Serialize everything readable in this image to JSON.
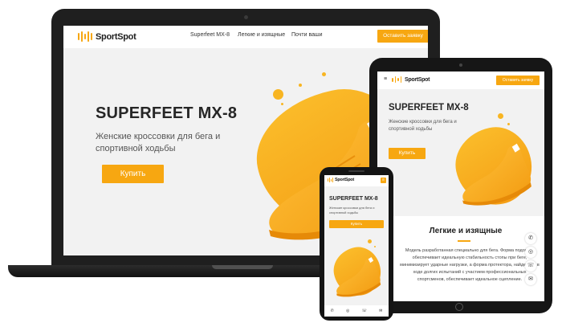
{
  "brand": {
    "name": "SportSpot",
    "color": "#f7a711"
  },
  "laptop": {
    "nav": [
      "Superfeet MX-8",
      "Легкие и изящные",
      "Почти ваши"
    ],
    "cta": "Оставить заявку",
    "hero_title": "SUPERFEET MX-8",
    "hero_subtitle": "Женские кроссовки для бега и спортивной ходьбы",
    "buy": "Купить"
  },
  "tablet": {
    "cta": "Оставить заявку",
    "hero_title": "SUPERFEET MX-8",
    "hero_subtitle": "Женские кроссовки для бега и спортивной ходьбы",
    "buy": "Купить",
    "section_title": "Легкие и изящные",
    "section_text": "Модель разработанная специально для бега. Форма подошвы обеспечивает идеальную стабильность стопы при беге, минимизирует ударные нагрузки, а форма протектора, найденная в ходе долгих испытаний с участием профессиональных спортсменов, обеспечивает идеальное сцепление.",
    "side_icons": [
      "phone-icon",
      "instagram-icon",
      "whatsapp-icon",
      "mail-icon"
    ]
  },
  "phone": {
    "hero_title": "SUPERFEET MX-8",
    "hero_subtitle": "Женские кроссовки для бега и спортивной ходьбы",
    "buy": "Купить",
    "bottom_icons": [
      "phone-icon",
      "instagram-icon",
      "whatsapp-icon",
      "mail-icon"
    ]
  }
}
